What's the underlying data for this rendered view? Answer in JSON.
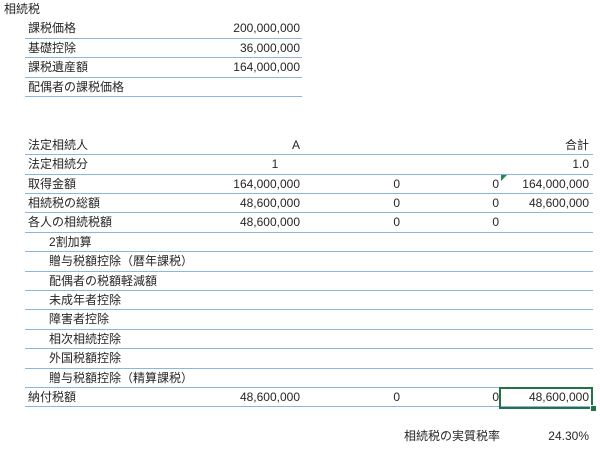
{
  "sheet": {
    "title": "相続税",
    "summary": [
      {
        "label": "課税価格",
        "value": "200,000,000"
      },
      {
        "label": "基礎控除",
        "value": "36,000,000"
      },
      {
        "label": "課税遺産額",
        "value": "164,000,000"
      },
      {
        "label": "配偶者の課税価格"
      }
    ],
    "heirs": {
      "header": {
        "label": "法定相続人",
        "a": "A",
        "total": "合計"
      },
      "rows": [
        {
          "label": "法定相続分",
          "a": "1",
          "total": "1.0"
        },
        {
          "label": "取得金額",
          "a": "164,000,000",
          "b": "0",
          "c": "0",
          "total": "164,000,000"
        },
        {
          "label": "相続税の総額",
          "a": "48,600,000",
          "b": "0",
          "c": "0",
          "total": "48,600,000"
        },
        {
          "label": "各人の相続税額",
          "a": "48,600,000",
          "b": "0",
          "c": "0"
        },
        {
          "label": "2割加算"
        },
        {
          "label": "贈与税額控除（暦年課税）"
        },
        {
          "label": "配偶者の税額軽減額"
        },
        {
          "label": "未成年者控除"
        },
        {
          "label": "障害者控除"
        },
        {
          "label": "相次相続控除"
        },
        {
          "label": "外国税額控除"
        },
        {
          "label": "贈与税額控除（精算課税）"
        },
        {
          "label": "納付税額",
          "a": "48,600,000",
          "b": "0",
          "c": "0",
          "total": "48,600,000"
        }
      ]
    },
    "effective_rate": {
      "label": "相続税の実質税率",
      "value": "24.30%"
    }
  },
  "colors": {
    "text": "#262626",
    "cell_border": "#8eb4e3",
    "selection": "#217346",
    "error_indicator": "#1e8c45"
  }
}
